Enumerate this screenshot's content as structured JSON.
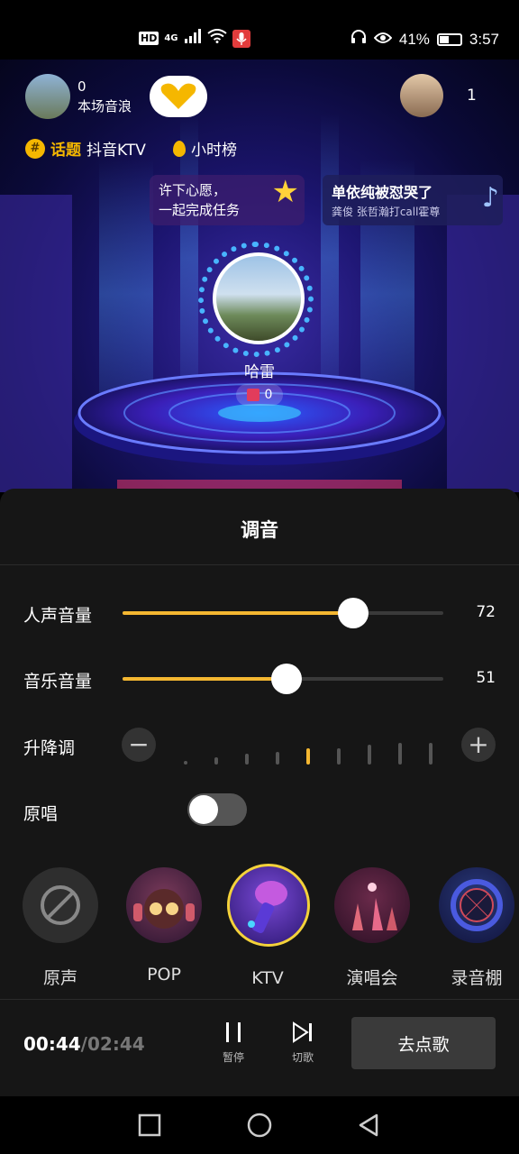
{
  "status_bar": {
    "hd": "HD",
    "network": "4G",
    "battery_percent": "41%",
    "time": "3:57"
  },
  "stage": {
    "host_wave_count": "0",
    "host_wave_label": "本场音浪",
    "viewer_count": "1",
    "topic_prefix": "话题",
    "topic_name": "抖音KTV",
    "hour_rank": "小时榜",
    "wish_line1": "许下心愿，",
    "wish_line2": "一起完成任务",
    "song_title": "单依纯被怼哭了",
    "song_subtitle": "龚俊 张哲瀚打call霍尊",
    "singer_name": "哈雷",
    "gift_count": "0"
  },
  "panel": {
    "title": "调音",
    "vocal_label": "人声音量",
    "vocal_value": "72",
    "vocal_level": 0.72,
    "music_label": "音乐音量",
    "music_value": "51",
    "music_level": 0.51,
    "pitch_label": "升降调",
    "original_label": "原唱",
    "original_on": false,
    "effects": [
      {
        "label": "原声",
        "icon": "disabled-icon",
        "selected": false
      },
      {
        "label": "POP",
        "icon": "pop-girl-icon",
        "selected": false
      },
      {
        "label": "KTV",
        "icon": "ktv-mic-icon",
        "selected": true
      },
      {
        "label": "演唱会",
        "icon": "concert-hands-icon",
        "selected": false
      },
      {
        "label": "录音棚",
        "icon": "studio-mic-icon",
        "selected": false
      }
    ]
  },
  "player": {
    "current_time": "00:44",
    "separator": "/",
    "total_time": "02:44",
    "pause_label": "暂停",
    "next_label": "切歌",
    "order_label": "去点歌"
  },
  "colors": {
    "accent": "#f4b731",
    "panel_bg": "#161616"
  }
}
